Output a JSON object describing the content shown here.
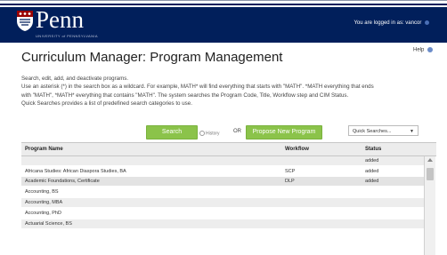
{
  "header": {
    "logo_text": "Penn",
    "logo_subtitle": "UNIVERSITY of PENNSYLVANIA",
    "logged_in": "You are logged in as: vancor"
  },
  "help_label": "Help",
  "page_title": "Curriculum Manager: Program Management",
  "description": [
    "Search, edit, add, and deactivate programs.",
    "Use an asterisk (*) in the search box as a wildcard. For example, MATH* will find everything that starts with \"MATH\". *MATH everything that ends",
    "with \"MATH\", *MATH* everything that contains \"MATH\". The system searches the Program Code, Title, Workflow step and CIM Status.",
    "Quick Searches provides a list of predefined search categories to use."
  ],
  "controls": {
    "search_label": "Search",
    "history_label": "History",
    "or_label": "OR",
    "propose_label": "Propose New Program",
    "quick_search_label": "Quick Searches..."
  },
  "table": {
    "columns": [
      "Program Name",
      "Workflow",
      "Status"
    ],
    "rows": [
      {
        "name": "",
        "workflow": "",
        "status": "added"
      },
      {
        "name": "Africana Studies: African Diaspora Studies, BA",
        "workflow": "SCP",
        "status": "added"
      },
      {
        "name": "Academic Foundations, Certificate",
        "workflow": "DLP",
        "status": "added"
      },
      {
        "name": "Accounting, BS",
        "workflow": "",
        "status": ""
      },
      {
        "name": "Accounting, MBA",
        "workflow": "",
        "status": ""
      },
      {
        "name": "Accounting, PhD",
        "workflow": "",
        "status": ""
      },
      {
        "name": "Actuarial Science, BS",
        "workflow": "",
        "status": ""
      }
    ]
  },
  "colors": {
    "header_bg": "#011f5b",
    "button_green": "#8bc34a"
  }
}
